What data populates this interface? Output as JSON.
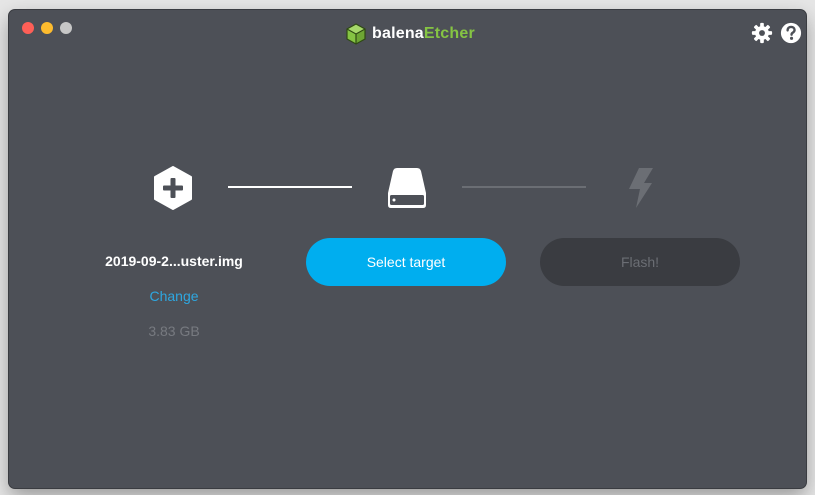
{
  "app": {
    "brand_prefix": "balena",
    "brand_suffix": "Etcher",
    "accent_color": "#85c443",
    "background_color": "#4d5057"
  },
  "icons": {
    "settings": "gear-icon",
    "help": "help-icon",
    "step1": "plus-hexagon-icon",
    "step2": "drive-icon",
    "step3": "lightning-icon"
  },
  "source": {
    "file_name": "2019-09-2...uster.img",
    "change_label": "Change",
    "size": "3.83 GB"
  },
  "target": {
    "button_label": "Select target",
    "button_color": "#00aeef"
  },
  "flash": {
    "button_label": "Flash!",
    "enabled": false
  }
}
